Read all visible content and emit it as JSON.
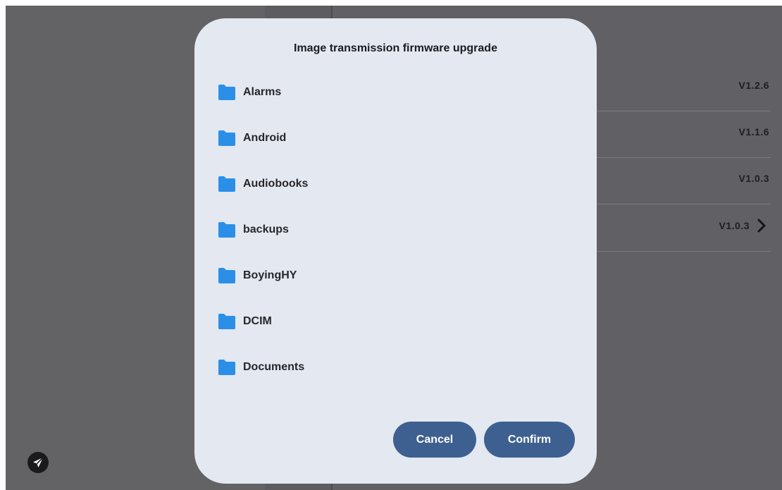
{
  "background": {
    "versions": [
      {
        "value": "V1.2.6",
        "has_chevron": false
      },
      {
        "value": "V1.1.6",
        "has_chevron": false
      },
      {
        "value": "V1.0.3",
        "has_chevron": false
      },
      {
        "value": "V1.0.3",
        "has_chevron": true
      }
    ],
    "send_icon": "paper-plane-icon"
  },
  "dialog": {
    "title": "Image transmission firmware upgrade",
    "folders": [
      {
        "name": "Alarms",
        "icon": "folder-icon"
      },
      {
        "name": "Android",
        "icon": "folder-icon"
      },
      {
        "name": "Audiobooks",
        "icon": "folder-icon"
      },
      {
        "name": "backups",
        "icon": "folder-icon"
      },
      {
        "name": "BoyingHY",
        "icon": "folder-icon"
      },
      {
        "name": "DCIM",
        "icon": "folder-icon"
      },
      {
        "name": "Documents",
        "icon": "folder-icon"
      }
    ],
    "cancel_label": "Cancel",
    "confirm_label": "Confirm"
  },
  "colors": {
    "accent_button": "#3e6090",
    "folder": "#2b8fe8",
    "dialog_bg": "#e3e8f1",
    "overlay_bg": "#5f5f63"
  }
}
